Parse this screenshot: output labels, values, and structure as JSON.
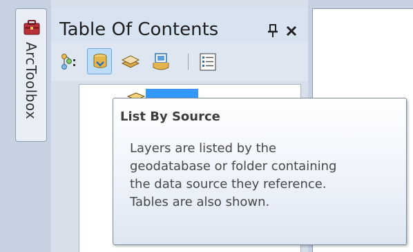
{
  "toolbox_tab": {
    "label": "ArcToolbox",
    "icon": "toolbox-icon"
  },
  "toc": {
    "title": "Table Of Contents",
    "pin_icon": "pin-icon",
    "close_icon": "close-icon",
    "toolbar": [
      {
        "name": "list-by-drawing-order",
        "icon": "list-by-drawing-order-icon",
        "active": false
      },
      {
        "name": "list-by-source",
        "icon": "list-by-source-icon",
        "active": true
      },
      {
        "name": "list-by-visibility",
        "icon": "list-by-visibility-icon",
        "active": false
      },
      {
        "name": "list-by-selection",
        "icon": "list-by-selection-icon",
        "active": false
      },
      {
        "name": "options",
        "icon": "options-icon",
        "active": false
      }
    ],
    "tree": {
      "layer_icon": "layers-icon",
      "editing_name": ""
    }
  },
  "tooltip": {
    "title": "List By Source",
    "lines": [
      "Layers are listed by the",
      "geodatabase or folder containing",
      "the data source they reference.",
      "Tables are also shown."
    ]
  },
  "colors": {
    "panel_bg": "#d7dfeb",
    "active_button": "#bcdcf7",
    "selection_blue": "#3399ff"
  }
}
